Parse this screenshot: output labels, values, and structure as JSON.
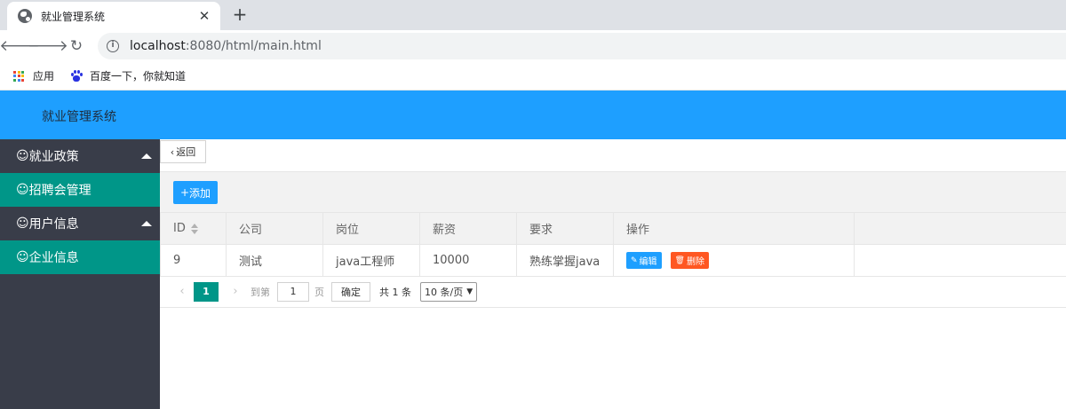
{
  "browser": {
    "tab_title": "就业管理系统",
    "tab_close": "✕",
    "new_tab": "+",
    "url_host": "localhost",
    "url_rest": ":8080/html/main.html",
    "bookmarks": [
      {
        "label": "应用",
        "icon": "apps-grid-icon"
      },
      {
        "label": "百度一下，你就知道",
        "icon": "baidu-paw-icon"
      }
    ]
  },
  "app": {
    "title": "就业管理系统",
    "header_color": "#1e9fff"
  },
  "sidebar": {
    "groups": [
      {
        "label": "就业政策",
        "expanded": true,
        "children": [
          "招聘会管理"
        ]
      },
      {
        "label": "用户信息",
        "expanded": true,
        "children": [
          "企业信息"
        ]
      }
    ],
    "icon": "☺"
  },
  "toolbar": {
    "back_label": "返回",
    "add_label": "添加"
  },
  "table": {
    "columns": [
      "ID",
      "公司",
      "岗位",
      "薪资",
      "要求",
      "操作"
    ],
    "rows": [
      {
        "id": "9",
        "company": "测试",
        "position": "java工程师",
        "salary": "10000",
        "requirement": "熟练掌握java",
        "edit_label": "编辑",
        "delete_label": "删除"
      }
    ]
  },
  "pagination": {
    "current_page": "1",
    "goto_label": "到第",
    "goto_value": "1",
    "page_label": "页",
    "confirm_label": "确定",
    "total_label": "共 1 条",
    "page_size_label": "10 条/页"
  },
  "colors": {
    "sidebar_bg": "#393d49",
    "sidebar_active": "#009688",
    "edit_btn": "#1e9fff",
    "delete_btn": "#ff5722"
  }
}
